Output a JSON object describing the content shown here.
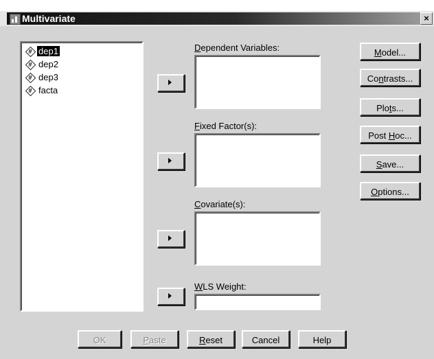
{
  "window": {
    "title": "Multivariate",
    "close_label": "×"
  },
  "variables": [
    {
      "name": "dep1",
      "selected": true
    },
    {
      "name": "dep2",
      "selected": false
    },
    {
      "name": "dep3",
      "selected": false
    },
    {
      "name": "facta",
      "selected": false
    }
  ],
  "var_icon_glyph": "#",
  "fields": {
    "dependent": {
      "label_pre": "",
      "label_u": "D",
      "label_post": "ependent Variables:"
    },
    "fixed": {
      "label_pre": "",
      "label_u": "F",
      "label_post": "ixed Factor(s):"
    },
    "covariate": {
      "label_pre": "",
      "label_u": "C",
      "label_post": "ovariate(s):"
    },
    "wls": {
      "label_pre": "",
      "label_u": "W",
      "label_post": "LS Weight:"
    }
  },
  "side_buttons": {
    "model": {
      "pre": "",
      "u": "M",
      "post": "odel..."
    },
    "contrasts": {
      "pre": "Co",
      "u": "n",
      "post": "trasts..."
    },
    "plots": {
      "pre": "Plo",
      "u": "t",
      "post": "s..."
    },
    "post_hoc": {
      "pre": "Post ",
      "u": "H",
      "post": "oc..."
    },
    "save": {
      "pre": "",
      "u": "S",
      "post": "ave..."
    },
    "options": {
      "pre": "",
      "u": "O",
      "post": "ptions..."
    }
  },
  "bottom_buttons": {
    "ok": {
      "label": "OK",
      "enabled": false
    },
    "paste": {
      "pre": "",
      "u": "P",
      "post": "aste",
      "enabled": false
    },
    "reset": {
      "pre": "",
      "u": "R",
      "post": "eset",
      "enabled": true
    },
    "cancel": {
      "label": "Cancel",
      "enabled": true
    },
    "help": {
      "label": "Help",
      "enabled": true
    }
  },
  "icons": {
    "app": "spss-app-icon",
    "close": "close-icon",
    "move": "right-arrow-icon",
    "variable": "scale-variable-icon"
  }
}
